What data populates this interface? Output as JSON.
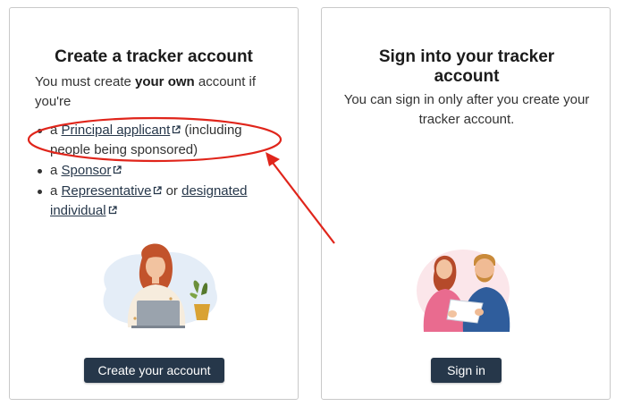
{
  "create_card": {
    "title": "Create a tracker account",
    "intro_prefix": "You must create ",
    "intro_bold": "your own",
    "intro_suffix": " account if you're",
    "bullets": [
      {
        "prefix": "a ",
        "link": "Principal applicant",
        "suffix": " (including people being sponsored)",
        "link2": "",
        "between": ""
      },
      {
        "prefix": "a ",
        "link": "Sponsor",
        "suffix": "",
        "link2": "",
        "between": ""
      },
      {
        "prefix": "a ",
        "link": "Representative",
        "between": " or ",
        "link2": "designated individual",
        "suffix": ""
      }
    ],
    "button_label": "Create your account"
  },
  "signin_card": {
    "title": "Sign into your tracker account",
    "description": "You can sign in only after you create your tracker account.",
    "button_label": "Sign in"
  },
  "colors": {
    "button_bg": "#26374a",
    "link": "#26374a",
    "annotation": "#e0251b"
  },
  "icons": [
    "external-link-icon"
  ]
}
